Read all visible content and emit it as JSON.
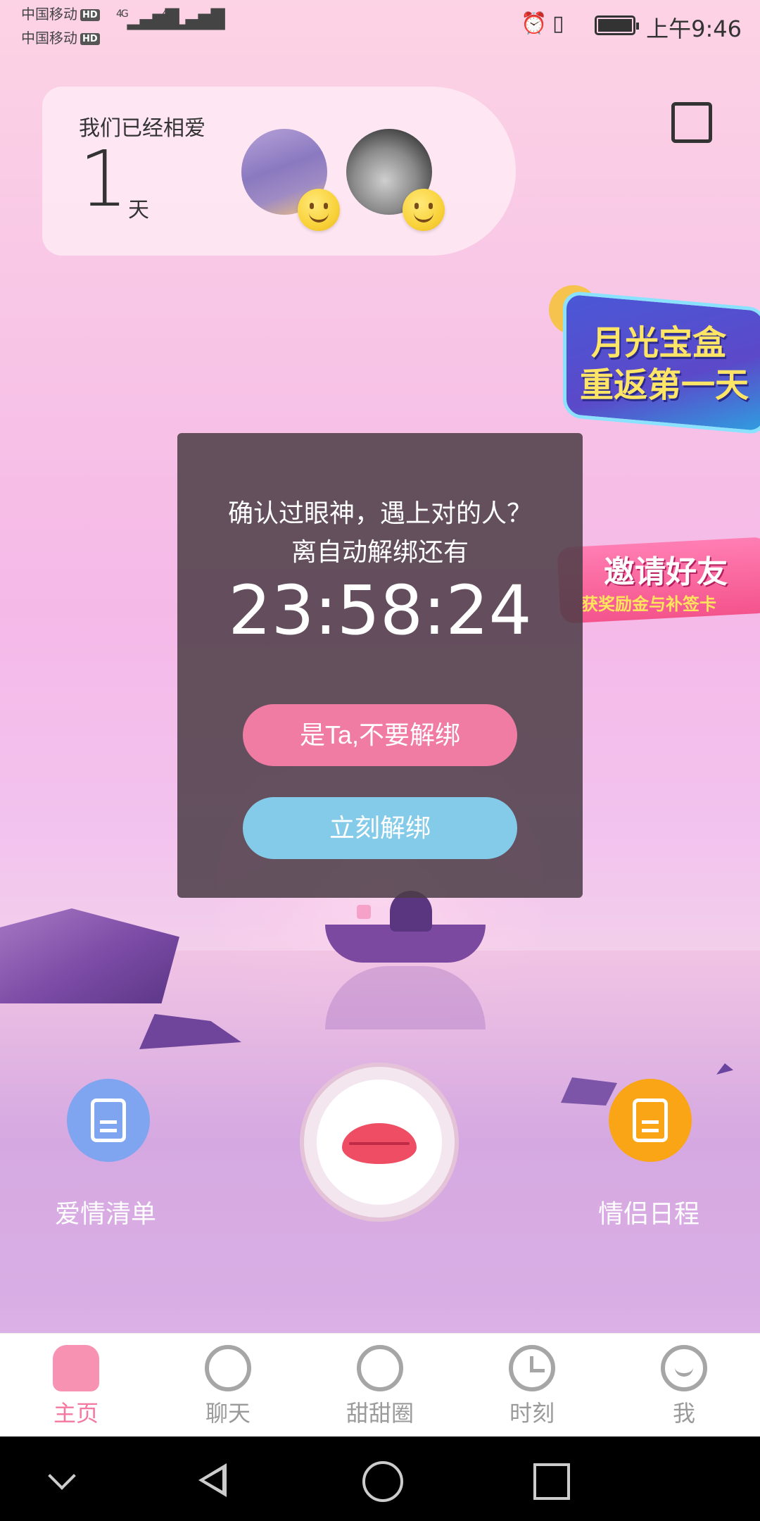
{
  "status_bar": {
    "carrier_1": "中国移动",
    "carrier_2": "中国移动",
    "hd_badge": "HD",
    "network_1": "4G",
    "network_2": "4G",
    "time": "上午9:46",
    "icons": [
      "signal-icon",
      "wifi-icon",
      "alarm-icon",
      "vibrate-icon",
      "battery-icon"
    ]
  },
  "love_card": {
    "label": "我们已经相爱",
    "days": "1",
    "unit": "天"
  },
  "promos": {
    "moon_box": {
      "line1": "月光宝盒",
      "line2": "重返第一天"
    },
    "invite": {
      "line1": "邀请好友",
      "line2": "获奖励金与补签卡"
    }
  },
  "dialog": {
    "question": "确认过眼神，遇上对的人？",
    "subtitle": "离自动解绑还有",
    "countdown": "23:58:24",
    "keep_button": "是Ta,不要解绑",
    "unbind_button": "立刻解绑"
  },
  "actions": {
    "love_list": "爱情清单",
    "couple_schedule": "情侣日程"
  },
  "bottom_nav": {
    "items": [
      {
        "label": "主页",
        "icon": "home-icon",
        "active": true
      },
      {
        "label": "聊天",
        "icon": "chat-icon",
        "active": false
      },
      {
        "label": "甜甜圈",
        "icon": "donut-icon",
        "active": false
      },
      {
        "label": "时刻",
        "icon": "clock-icon",
        "active": false
      },
      {
        "label": "我",
        "icon": "profile-icon",
        "active": false
      }
    ]
  },
  "colors": {
    "accent_pink": "#f07ba3",
    "accent_blue": "#83cbe8",
    "active_nav": "#f4789f",
    "list_icon_bg": "#7fa4f0",
    "schedule_icon_bg": "#f9a516"
  }
}
